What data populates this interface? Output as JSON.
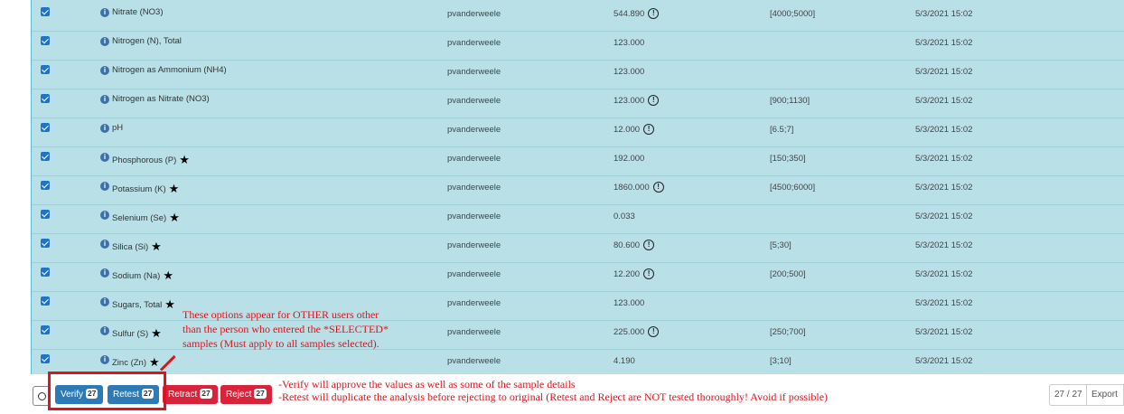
{
  "rows": [
    {
      "name": "Nitrate (NO3)",
      "star": false,
      "user": "pvanderweele",
      "value": "544.890",
      "warn": true,
      "range": "[4000;5000]",
      "date": "5/3/2021 15:02"
    },
    {
      "name": "Nitrogen (N), Total",
      "star": false,
      "user": "pvanderweele",
      "value": "123.000",
      "warn": false,
      "range": "",
      "date": "5/3/2021 15:02"
    },
    {
      "name": "Nitrogen as Ammonium (NH4)",
      "star": false,
      "user": "pvanderweele",
      "value": "123.000",
      "warn": false,
      "range": "",
      "date": "5/3/2021 15:02"
    },
    {
      "name": "Nitrogen as Nitrate (NO3)",
      "star": false,
      "user": "pvanderweele",
      "value": "123.000",
      "warn": true,
      "range": "[900;1130]",
      "date": "5/3/2021 15:02"
    },
    {
      "name": "pH",
      "star": false,
      "user": "pvanderweele",
      "value": "12.000",
      "warn": true,
      "range": "[6.5;7]",
      "date": "5/3/2021 15:02"
    },
    {
      "name": "Phosphorous (P)",
      "star": true,
      "user": "pvanderweele",
      "value": "192.000",
      "warn": false,
      "range": "[150;350]",
      "date": "5/3/2021 15:02"
    },
    {
      "name": "Potassium (K)",
      "star": true,
      "user": "pvanderweele",
      "value": "1860.000",
      "warn": true,
      "range": "[4500;6000]",
      "date": "5/3/2021 15:02"
    },
    {
      "name": "Selenium (Se)",
      "star": true,
      "user": "pvanderweele",
      "value": "0.033",
      "warn": false,
      "range": "",
      "date": "5/3/2021 15:02"
    },
    {
      "name": "Silica (Si)",
      "star": true,
      "user": "pvanderweele",
      "value": "80.600",
      "warn": true,
      "range": "[5;30]",
      "date": "5/3/2021 15:02"
    },
    {
      "name": "Sodium (Na)",
      "star": true,
      "user": "pvanderweele",
      "value": "12.200",
      "warn": true,
      "range": "[200;500]",
      "date": "5/3/2021 15:02"
    },
    {
      "name": "Sugars, Total",
      "star": true,
      "user": "pvanderweele",
      "value": "123.000",
      "warn": false,
      "range": "",
      "date": "5/3/2021 15:02"
    },
    {
      "name": "Sulfur (S)",
      "star": true,
      "user": "pvanderweele",
      "value": "225.000",
      "warn": true,
      "range": "[250;700]",
      "date": "5/3/2021 15:02"
    },
    {
      "name": "Zinc (Zn)",
      "star": true,
      "user": "pvanderweele",
      "value": "4.190",
      "warn": false,
      "range": "[3;10]",
      "date": "5/3/2021 15:02"
    }
  ],
  "icons": {
    "checkbox": "checkbox-checked-icon",
    "info": "info-icon",
    "star": "star-icon",
    "warning": "exclamation-circle-icon",
    "info_glyph": "i",
    "star_glyph": "★",
    "warn_glyph": "!"
  },
  "footer": {
    "verify_label": "Verify",
    "verify_count": "27",
    "retest_label": "Retest",
    "retest_count": "27",
    "retract_label": "Retract",
    "retract_count": "27",
    "reject_label": "Reject",
    "reject_count": "27",
    "pager_count": "27 / 27",
    "export_label": "Export"
  },
  "annotations": {
    "note_top": "These options appear for OTHER users other than the person who entered the *SELECTED* samples (Must apply to all samples selected).",
    "note_bottom_1": "-Verify will approve the values as well as some of the sample details",
    "note_bottom_2": "-Retest will duplicate the analysis before rejecting to original (Retest and Reject are NOT tested thoroughly! Avoid if possible)"
  },
  "colors": {
    "row_bg": "#b8e0e6",
    "checkbox": "#1f74c9",
    "verify_btn": "#2d7bb6",
    "reject_btn": "#d9233a",
    "annotation": "#e0131c"
  }
}
